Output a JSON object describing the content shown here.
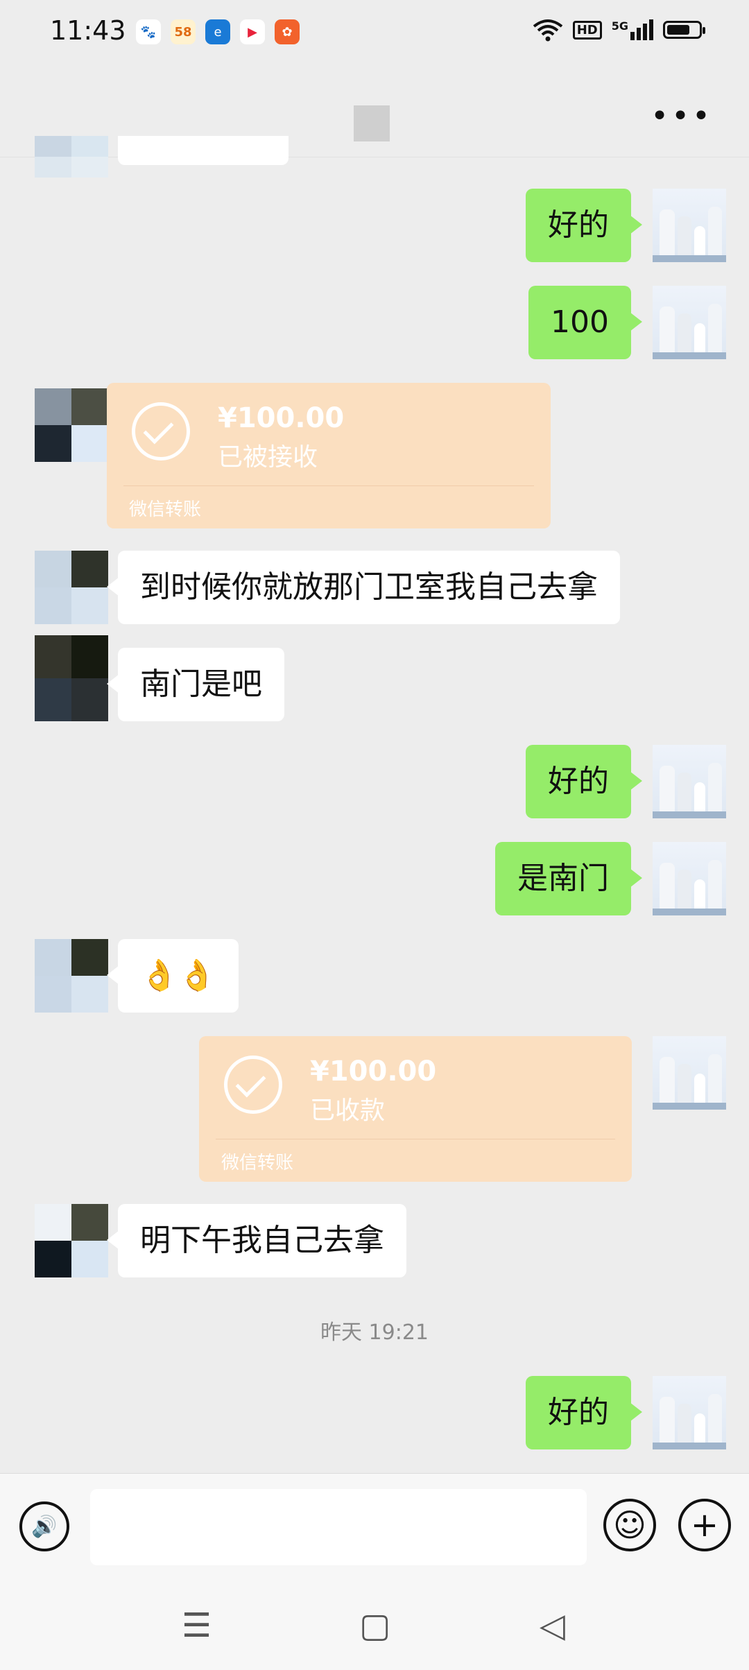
{
  "status_bar": {
    "time": "11:43",
    "apps": [
      {
        "name": "baidu-icon",
        "glyph": "🐾",
        "color": "#2a62d6"
      },
      {
        "name": "58-icon",
        "glyph": "58",
        "color": "#f3b93c"
      },
      {
        "name": "browser-icon",
        "glyph": "e",
        "color": "#1a7ad6"
      },
      {
        "name": "video-icon",
        "glyph": "▶",
        "color": "#e8233b"
      },
      {
        "name": "kuaishou-icon",
        "glyph": "✿",
        "color": "#f2622c"
      }
    ],
    "hd": "HD",
    "network": "5G"
  },
  "header": {
    "more": "•••"
  },
  "messages": {
    "m1": "好的",
    "m2": "100",
    "t1_amount": "¥100.00",
    "t1_status": "已被接收",
    "t1_source": "微信转账",
    "m3": "到时候你就放那门卫室我自己去拿",
    "m4": "南门是吧",
    "m5": "好的",
    "m6": "是南门",
    "m7": "👌👌",
    "t2_amount": "¥100.00",
    "t2_status": "已收款",
    "t2_source": "微信转账",
    "m8": "明下午我自己去拿",
    "timestamp": "昨天 19:21",
    "m9": "好的"
  },
  "input_bar": {
    "voice": "🔊",
    "emoji": "☺",
    "plus": "+"
  },
  "nav_bar": {
    "menu": "☰",
    "home": "▢",
    "back": "◁"
  },
  "colors": {
    "background": "#ededed",
    "my_bubble": "#95ec69",
    "their_bubble": "#ffffff",
    "transfer": "#fbdfc0"
  }
}
